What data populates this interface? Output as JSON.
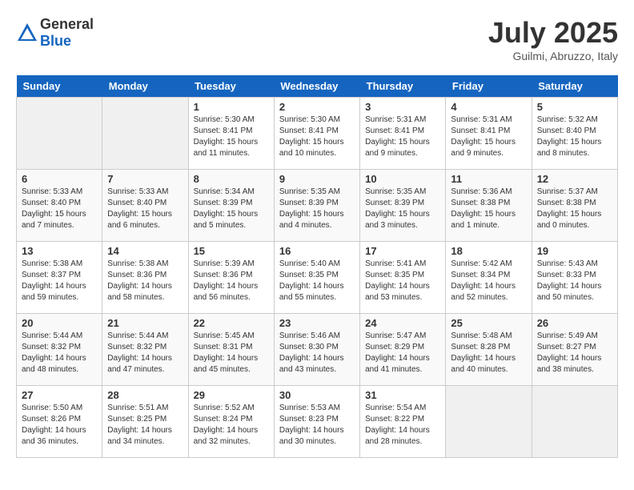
{
  "header": {
    "logo": {
      "general": "General",
      "blue": "Blue"
    },
    "title": "July 2025",
    "subtitle": "Guilmi, Abruzzo, Italy"
  },
  "weekdays": [
    "Sunday",
    "Monday",
    "Tuesday",
    "Wednesday",
    "Thursday",
    "Friday",
    "Saturday"
  ],
  "weeks": [
    [
      {
        "day": null,
        "empty": true
      },
      {
        "day": null,
        "empty": true
      },
      {
        "day": "1",
        "sunrise": "5:30 AM",
        "sunset": "8:41 PM",
        "daylight": "15 hours and 11 minutes."
      },
      {
        "day": "2",
        "sunrise": "5:30 AM",
        "sunset": "8:41 PM",
        "daylight": "15 hours and 10 minutes."
      },
      {
        "day": "3",
        "sunrise": "5:31 AM",
        "sunset": "8:41 PM",
        "daylight": "15 hours and 9 minutes."
      },
      {
        "day": "4",
        "sunrise": "5:31 AM",
        "sunset": "8:41 PM",
        "daylight": "15 hours and 9 minutes."
      },
      {
        "day": "5",
        "sunrise": "5:32 AM",
        "sunset": "8:40 PM",
        "daylight": "15 hours and 8 minutes."
      }
    ],
    [
      {
        "day": "6",
        "sunrise": "5:33 AM",
        "sunset": "8:40 PM",
        "daylight": "15 hours and 7 minutes."
      },
      {
        "day": "7",
        "sunrise": "5:33 AM",
        "sunset": "8:40 PM",
        "daylight": "15 hours and 6 minutes."
      },
      {
        "day": "8",
        "sunrise": "5:34 AM",
        "sunset": "8:39 PM",
        "daylight": "15 hours and 5 minutes."
      },
      {
        "day": "9",
        "sunrise": "5:35 AM",
        "sunset": "8:39 PM",
        "daylight": "15 hours and 4 minutes."
      },
      {
        "day": "10",
        "sunrise": "5:35 AM",
        "sunset": "8:39 PM",
        "daylight": "15 hours and 3 minutes."
      },
      {
        "day": "11",
        "sunrise": "5:36 AM",
        "sunset": "8:38 PM",
        "daylight": "15 hours and 1 minute."
      },
      {
        "day": "12",
        "sunrise": "5:37 AM",
        "sunset": "8:38 PM",
        "daylight": "15 hours and 0 minutes."
      }
    ],
    [
      {
        "day": "13",
        "sunrise": "5:38 AM",
        "sunset": "8:37 PM",
        "daylight": "14 hours and 59 minutes."
      },
      {
        "day": "14",
        "sunrise": "5:38 AM",
        "sunset": "8:36 PM",
        "daylight": "14 hours and 58 minutes."
      },
      {
        "day": "15",
        "sunrise": "5:39 AM",
        "sunset": "8:36 PM",
        "daylight": "14 hours and 56 minutes."
      },
      {
        "day": "16",
        "sunrise": "5:40 AM",
        "sunset": "8:35 PM",
        "daylight": "14 hours and 55 minutes."
      },
      {
        "day": "17",
        "sunrise": "5:41 AM",
        "sunset": "8:35 PM",
        "daylight": "14 hours and 53 minutes."
      },
      {
        "day": "18",
        "sunrise": "5:42 AM",
        "sunset": "8:34 PM",
        "daylight": "14 hours and 52 minutes."
      },
      {
        "day": "19",
        "sunrise": "5:43 AM",
        "sunset": "8:33 PM",
        "daylight": "14 hours and 50 minutes."
      }
    ],
    [
      {
        "day": "20",
        "sunrise": "5:44 AM",
        "sunset": "8:32 PM",
        "daylight": "14 hours and 48 minutes."
      },
      {
        "day": "21",
        "sunrise": "5:44 AM",
        "sunset": "8:32 PM",
        "daylight": "14 hours and 47 minutes."
      },
      {
        "day": "22",
        "sunrise": "5:45 AM",
        "sunset": "8:31 PM",
        "daylight": "14 hours and 45 minutes."
      },
      {
        "day": "23",
        "sunrise": "5:46 AM",
        "sunset": "8:30 PM",
        "daylight": "14 hours and 43 minutes."
      },
      {
        "day": "24",
        "sunrise": "5:47 AM",
        "sunset": "8:29 PM",
        "daylight": "14 hours and 41 minutes."
      },
      {
        "day": "25",
        "sunrise": "5:48 AM",
        "sunset": "8:28 PM",
        "daylight": "14 hours and 40 minutes."
      },
      {
        "day": "26",
        "sunrise": "5:49 AM",
        "sunset": "8:27 PM",
        "daylight": "14 hours and 38 minutes."
      }
    ],
    [
      {
        "day": "27",
        "sunrise": "5:50 AM",
        "sunset": "8:26 PM",
        "daylight": "14 hours and 36 minutes."
      },
      {
        "day": "28",
        "sunrise": "5:51 AM",
        "sunset": "8:25 PM",
        "daylight": "14 hours and 34 minutes."
      },
      {
        "day": "29",
        "sunrise": "5:52 AM",
        "sunset": "8:24 PM",
        "daylight": "14 hours and 32 minutes."
      },
      {
        "day": "30",
        "sunrise": "5:53 AM",
        "sunset": "8:23 PM",
        "daylight": "14 hours and 30 minutes."
      },
      {
        "day": "31",
        "sunrise": "5:54 AM",
        "sunset": "8:22 PM",
        "daylight": "14 hours and 28 minutes."
      },
      {
        "day": null,
        "empty": true
      },
      {
        "day": null,
        "empty": true
      }
    ]
  ]
}
